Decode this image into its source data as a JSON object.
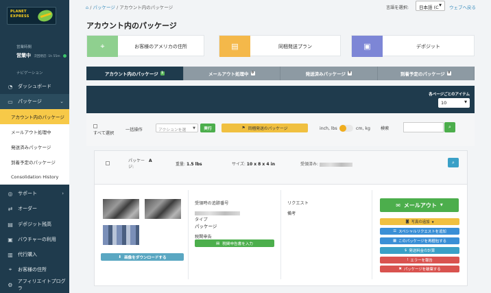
{
  "sidebar": {
    "logo_line1": "PLANET",
    "logo_line2": "EXPRESS",
    "hours_label": "営業時間",
    "status_label": "営業中",
    "status_sub": "次回閉店: 1h 55m",
    "nav_heading": "ナビゲーション",
    "items": [
      {
        "label": "ダッシュボード",
        "icon": "dashboard-icon"
      },
      {
        "label": "パッケージ",
        "icon": "package-icon"
      },
      {
        "label": "サポート",
        "icon": "support-icon"
      },
      {
        "label": "オーダー",
        "icon": "order-icon"
      },
      {
        "label": "デポジット残高",
        "icon": "deposit-icon"
      },
      {
        "label": "バウチャーの利用",
        "icon": "voucher-icon"
      },
      {
        "label": "代行購入",
        "icon": "shopping-icon"
      },
      {
        "label": "お客様の住所",
        "icon": "location-icon"
      },
      {
        "label": "アフィリエイトプログラ",
        "icon": "affiliate-icon"
      }
    ],
    "sub_items": [
      "アカウント内のパッケージ",
      "メールアウト処理中",
      "発送済みパッケージ",
      "到着予定のパッケージ",
      "Consolidation History"
    ]
  },
  "topbar": {
    "crumb_sep": "/",
    "crumb_1": "パッケージ",
    "crumb_2": "アカウント内のパッケージ",
    "lang_label": "言語を選択:",
    "lang_value": "日本語 (C",
    "back_link": "ウェブへ戻る"
  },
  "page_title": "アカウント内のパッケージ",
  "cards": [
    {
      "label": "お客様のアメリカの住所",
      "color": "#8fd08f",
      "icon": "location-pin-icon"
    },
    {
      "label": "同梱発送プラン",
      "color": "#f4b84a",
      "icon": "clipboard-icon"
    },
    {
      "label": "デポジット",
      "color": "#7d86d6",
      "icon": "gift-icon"
    }
  ],
  "tabs": [
    {
      "label": "アカウント内のパッケージ",
      "count": "1"
    },
    {
      "label": "メールアウト処理中",
      "count": "0"
    },
    {
      "label": "発送済みパッケージ",
      "count": "0"
    },
    {
      "label": "到着予定のパッケージ",
      "count": "0"
    }
  ],
  "per_page": {
    "label": "各ページごとのアイテム",
    "value": "10"
  },
  "filter": {
    "select_all": "すべて選択",
    "bulk_label": "一括操作",
    "bulk_placeholder": "アクションを選",
    "execute": "実行",
    "combine": "同梱発送のパッケージ",
    "unit_imperial": "inch, lbs",
    "unit_metric": "cm, kg",
    "search_label": "検索",
    "unit_toggle_state": "imperial"
  },
  "package": {
    "name_label": "パッケー",
    "name_label2": "ジ:",
    "name_value": "A",
    "weight_label": "重量:",
    "weight_value": "1.5 lbs",
    "size_label": "サイズ:",
    "size_value": "10 x 8 x 4 in",
    "received_label": "受領済み:",
    "download_btn": "画像をダウンロードする",
    "tracking_label": "受領時の追跡番号",
    "type_label": "タイプ",
    "type_value": "パッケージ",
    "customs_label": "税関申告",
    "customs_btn": "税関申告書を入力",
    "request_label": "リクエスト",
    "notes_label": "備考",
    "mailout_btn": "メールアウト",
    "actions": [
      {
        "label": "写真の追加",
        "color": "#f0c040",
        "icon": "camera-icon"
      },
      {
        "label": "スペシャルリクエストを追加",
        "color": "#3a8fd6",
        "icon": "list-icon"
      },
      {
        "label": "このパッケージを再梱包する",
        "color": "#3a8fd6",
        "icon": "box-icon"
      },
      {
        "label": "発送料金の計算",
        "color": "#3aa0c7",
        "icon": "dollar-icon"
      },
      {
        "label": "エラーを報告",
        "color": "#d9534f",
        "icon": "exclamation-icon"
      },
      {
        "label": "パッケージを破棄する",
        "color": "#d9534f",
        "icon": "trash-icon"
      }
    ]
  }
}
